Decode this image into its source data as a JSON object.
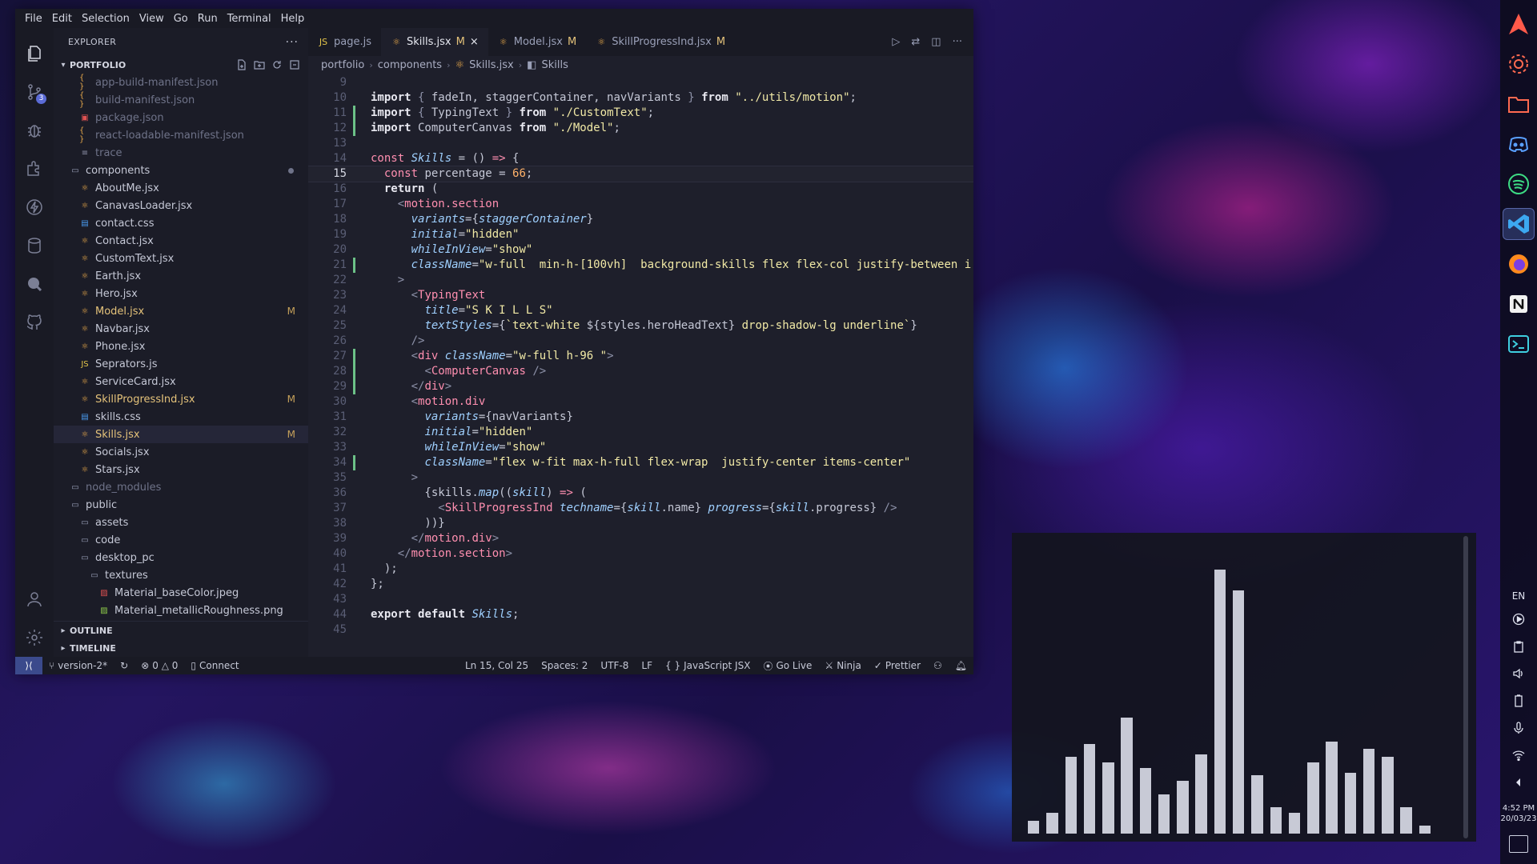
{
  "menu": [
    "File",
    "Edit",
    "Selection",
    "View",
    "Go",
    "Run",
    "Terminal",
    "Help"
  ],
  "activity": {
    "scm_badge": "3"
  },
  "sidebar": {
    "title": "EXPLORER",
    "section": "PORTFOLIO",
    "files": [
      {
        "label": "app-build-manifest.json",
        "indent": 2,
        "type": "json",
        "dim": true
      },
      {
        "label": "build-manifest.json",
        "indent": 2,
        "type": "json",
        "dim": true
      },
      {
        "label": "package.json",
        "indent": 2,
        "type": "pkg",
        "dim": true
      },
      {
        "label": "react-loadable-manifest.json",
        "indent": 2,
        "type": "json",
        "dim": true
      },
      {
        "label": "trace",
        "indent": 2,
        "type": "file",
        "dim": true
      },
      {
        "label": "components",
        "indent": 1,
        "type": "folder",
        "dot": true
      },
      {
        "label": "AboutMe.jsx",
        "indent": 2,
        "type": "react"
      },
      {
        "label": "CanavasLoader.jsx",
        "indent": 2,
        "type": "react"
      },
      {
        "label": "contact.css",
        "indent": 2,
        "type": "css"
      },
      {
        "label": "Contact.jsx",
        "indent": 2,
        "type": "react"
      },
      {
        "label": "CustomText.jsx",
        "indent": 2,
        "type": "react"
      },
      {
        "label": "Earth.jsx",
        "indent": 2,
        "type": "react"
      },
      {
        "label": "Hero.jsx",
        "indent": 2,
        "type": "react"
      },
      {
        "label": "Model.jsx",
        "indent": 2,
        "type": "react",
        "mod": "M"
      },
      {
        "label": "Navbar.jsx",
        "indent": 2,
        "type": "react"
      },
      {
        "label": "Phone.jsx",
        "indent": 2,
        "type": "react"
      },
      {
        "label": "Seprators.js",
        "indent": 2,
        "type": "js"
      },
      {
        "label": "ServiceCard.jsx",
        "indent": 2,
        "type": "react"
      },
      {
        "label": "SkillProgressInd.jsx",
        "indent": 2,
        "type": "react",
        "mod": "M"
      },
      {
        "label": "skills.css",
        "indent": 2,
        "type": "css"
      },
      {
        "label": "Skills.jsx",
        "indent": 2,
        "type": "react",
        "mod": "M",
        "selected": true
      },
      {
        "label": "Socials.jsx",
        "indent": 2,
        "type": "react"
      },
      {
        "label": "Stars.jsx",
        "indent": 2,
        "type": "react"
      },
      {
        "label": "node_modules",
        "indent": 1,
        "type": "folder",
        "dim": true
      },
      {
        "label": "public",
        "indent": 1,
        "type": "folder"
      },
      {
        "label": "assets",
        "indent": 2,
        "type": "folder"
      },
      {
        "label": "code",
        "indent": 2,
        "type": "folder"
      },
      {
        "label": "desktop_pc",
        "indent": 2,
        "type": "folder"
      },
      {
        "label": "textures",
        "indent": 3,
        "type": "folder"
      },
      {
        "label": "Material_baseColor.jpeg",
        "indent": 4,
        "type": "img"
      },
      {
        "label": "Material_metallicRoughness.png",
        "indent": 4,
        "type": "png"
      }
    ],
    "outline": "OUTLINE",
    "timeline": "TIMELINE"
  },
  "tabs": [
    {
      "label": "page.js",
      "mod": "",
      "icon": "JS"
    },
    {
      "label": "Skills.jsx",
      "mod": "M",
      "active": true,
      "close": "×"
    },
    {
      "label": "Model.jsx",
      "mod": "M"
    },
    {
      "label": "SkillProgressInd.jsx",
      "mod": "M"
    }
  ],
  "breadcrumb": [
    "portfolio",
    "components",
    "Skills.jsx",
    "Skills"
  ],
  "code_lines": [
    {
      "n": "9",
      "git": "",
      "html": ""
    },
    {
      "n": "10",
      "git": "",
      "html": "<span class='k'>import</span> <span class='p'>{</span> fadeIn, staggerContainer, navVariants <span class='p'>}</span> <span class='k'>from</span> <span class='s'>\"../utils/motion\"</span>;"
    },
    {
      "n": "11",
      "git": "g",
      "html": "<span class='k'>import</span> <span class='p'>{</span> TypingText <span class='p'>}</span> <span class='k'>from</span> <span class='s'>\"./CustomText\"</span>;"
    },
    {
      "n": "12",
      "git": "g",
      "html": "<span class='k'>import</span> ComputerCanvas <span class='k'>from</span> <span class='s'>\"./Model\"</span>;"
    },
    {
      "n": "13",
      "git": "",
      "html": ""
    },
    {
      "n": "14",
      "git": "",
      "html": "<span class='t'>const</span> <span class='f'>Skills</span> = () <span class='t'>=&gt;</span> {"
    },
    {
      "n": "15",
      "git": "",
      "cur": true,
      "html": "  <span class='t'>const</span> percentage = <span class='n'>66</span>;"
    },
    {
      "n": "16",
      "git": "",
      "html": "  <span class='k'>return</span> ("
    },
    {
      "n": "17",
      "git": "",
      "html": "    <span class='p'>&lt;</span><span class='t'>motion.section</span>"
    },
    {
      "n": "18",
      "git": "",
      "html": "      <span class='a'>variants</span>={<span class='f'>staggerContainer</span>}"
    },
    {
      "n": "19",
      "git": "",
      "html": "      <span class='a'>initial</span>=<span class='s'>\"hidden\"</span>"
    },
    {
      "n": "20",
      "git": "",
      "html": "      <span class='a'>whileInView</span>=<span class='s'>\"show\"</span>"
    },
    {
      "n": "21",
      "git": "g",
      "html": "      <span class='a'>className</span>=<span class='s'>\"w-full  min-h-[100vh]  background-skills flex flex-col justify-between i</span>"
    },
    {
      "n": "22",
      "git": "",
      "html": "    <span class='p'>&gt;</span>"
    },
    {
      "n": "23",
      "git": "",
      "html": "      <span class='p'>&lt;</span><span class='t'>TypingText</span>"
    },
    {
      "n": "24",
      "git": "",
      "html": "        <span class='a'>title</span>=<span class='s'>\"S K I L L S\"</span>"
    },
    {
      "n": "25",
      "git": "",
      "html": "        <span class='a'>textStyles</span>={<span class='s'>`text-white </span>${styles.heroHeadText}<span class='s'> drop-shadow-lg underline`</span>}"
    },
    {
      "n": "26",
      "git": "",
      "html": "      <span class='p'>/&gt;</span>"
    },
    {
      "n": "27",
      "git": "g",
      "html": "      <span class='p'>&lt;</span><span class='t'>div</span> <span class='a'>className</span>=<span class='s'>\"w-full h-96 \"</span><span class='p'>&gt;</span>"
    },
    {
      "n": "28",
      "git": "g",
      "html": "        <span class='p'>&lt;</span><span class='t'>ComputerCanvas</span> <span class='p'>/&gt;</span>"
    },
    {
      "n": "29",
      "git": "g",
      "html": "      <span class='p'>&lt;/</span><span class='t'>div</span><span class='p'>&gt;</span>"
    },
    {
      "n": "30",
      "git": "",
      "html": "      <span class='p'>&lt;</span><span class='t'>motion.div</span>"
    },
    {
      "n": "31",
      "git": "",
      "html": "        <span class='a'>variants</span>={navVariants}"
    },
    {
      "n": "32",
      "git": "",
      "html": "        <span class='a'>initial</span>=<span class='s'>\"hidden\"</span>"
    },
    {
      "n": "33",
      "git": "",
      "html": "        <span class='a'>whileInView</span>=<span class='s'>\"show\"</span>"
    },
    {
      "n": "34",
      "git": "g",
      "html": "        <span class='a'>className</span>=<span class='s'>\"flex w-fit max-h-full flex-wrap  justify-center items-center\"</span>"
    },
    {
      "n": "35",
      "git": "",
      "html": "      <span class='p'>&gt;</span>"
    },
    {
      "n": "36",
      "git": "",
      "html": "        {skills.<span class='f'>map</span>((<span class='f'>skill</span>) <span class='t'>=&gt;</span> ("
    },
    {
      "n": "37",
      "git": "",
      "html": "          <span class='p'>&lt;</span><span class='t'>SkillProgressInd</span> <span class='a'>techname</span>={<span class='f'>skill</span>.name} <span class='a'>progress</span>={<span class='f'>skill</span>.progress} <span class='p'>/&gt;</span>"
    },
    {
      "n": "38",
      "git": "",
      "html": "        ))}"
    },
    {
      "n": "39",
      "git": "",
      "html": "      <span class='p'>&lt;/</span><span class='t'>motion.div</span><span class='p'>&gt;</span>"
    },
    {
      "n": "40",
      "git": "",
      "html": "    <span class='p'>&lt;/</span><span class='t'>motion.section</span><span class='p'>&gt;</span>"
    },
    {
      "n": "41",
      "git": "",
      "html": "  );"
    },
    {
      "n": "42",
      "git": "",
      "html": "};"
    },
    {
      "n": "43",
      "git": "",
      "html": ""
    },
    {
      "n": "44",
      "git": "",
      "html": "<span class='k'>export</span> <span class='k'>default</span> <span class='f'>Skills</span>;"
    },
    {
      "n": "45",
      "git": "",
      "html": ""
    }
  ],
  "status": {
    "branch": "version-2*",
    "problems": "0 △ 0",
    "connect": "Connect",
    "position": "Ln 15, Col 25",
    "spaces": "Spaces: 2",
    "encoding": "UTF-8",
    "eol": "LF",
    "language": "JavaScript JSX",
    "golive": "Go Live",
    "ninja": "Ninja",
    "prettier": "Prettier"
  },
  "tray": {
    "lang": "EN",
    "time": "4:52 PM",
    "date": "20/03/23"
  },
  "visualizer": {
    "max": 1.0,
    "levels": [
      0.05,
      0.08,
      0.29,
      0.34,
      0.27,
      0.44,
      0.25,
      0.15,
      0.2,
      0.3,
      1.0,
      0.92,
      0.22,
      0.1,
      0.08,
      0.27,
      0.35,
      0.23,
      0.32,
      0.29,
      0.1,
      0.03
    ]
  }
}
